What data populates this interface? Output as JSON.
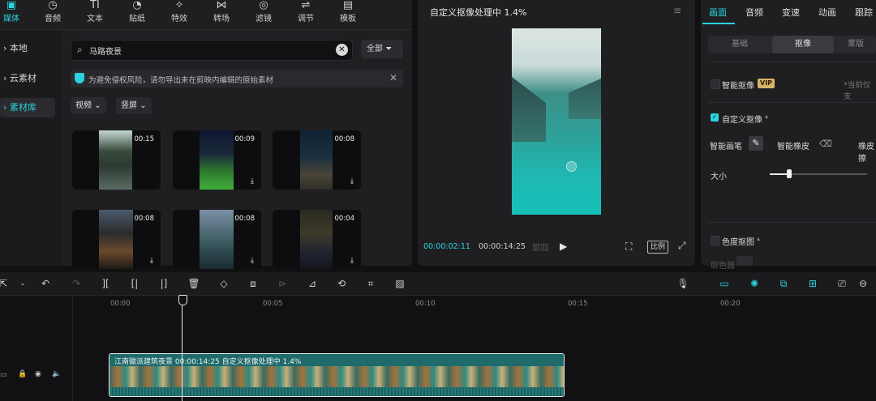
{
  "top_tabs": [
    {
      "label": "媒体",
      "icon": "media-icon"
    },
    {
      "label": "音频",
      "icon": "audio-icon"
    },
    {
      "label": "文本",
      "icon": "text-icon"
    },
    {
      "label": "贴纸",
      "icon": "sticker-icon"
    },
    {
      "label": "特效",
      "icon": "effects-icon"
    },
    {
      "label": "转场",
      "icon": "transition-icon"
    },
    {
      "label": "滤镜",
      "icon": "filter-icon"
    },
    {
      "label": "调节",
      "icon": "adjust-icon"
    },
    {
      "label": "模板",
      "icon": "template-icon"
    }
  ],
  "side_nav": [
    {
      "label": "本地"
    },
    {
      "label": "云素材"
    },
    {
      "label": "素材库"
    }
  ],
  "search": {
    "value": "马路夜景"
  },
  "filter_all": "全部",
  "notice": "为避免侵权风险，请勿导出未在剪映内编辑的原始素材",
  "dropdowns": [
    "视频",
    "竖屏"
  ],
  "media_cards": [
    {
      "duration": "00:15"
    },
    {
      "duration": "00:09"
    },
    {
      "duration": "00:08"
    },
    {
      "duration": "00:08"
    },
    {
      "duration": "00:08"
    },
    {
      "duration": "00:04"
    }
  ],
  "preview": {
    "title": "自定义抠像处理中 1.4%",
    "current_time": "00:00:02:11",
    "total_time": "00:00:14:25",
    "ratio_label": "比例"
  },
  "right_tabs": [
    "画面",
    "音频",
    "变速",
    "动画",
    "跟踪"
  ],
  "segments": [
    "基础",
    "抠像",
    "蒙版"
  ],
  "smart_cutout": {
    "label": "智能抠像",
    "badge": "VIP",
    "hint": "*当前仅支"
  },
  "custom_cutout": {
    "label": "自定义抠像"
  },
  "tools": {
    "brush": "智能画笔",
    "eraser": "智能橡皮",
    "eraser2": "橡皮擦"
  },
  "size_label": "大小",
  "size_value": 0.2,
  "chroma": {
    "label": "色度抠图",
    "sub": "取色器"
  },
  "ruler_ticks": [
    "00:00",
    "00:05",
    "00:10",
    "00:15",
    "00:20"
  ],
  "clip": {
    "label": "江南徽派建筑夜景   00:00:14:25   自定义抠像处理中 1.4%"
  },
  "colors": {
    "accent": "#2ad4df",
    "clip": "#1b5b5d"
  }
}
